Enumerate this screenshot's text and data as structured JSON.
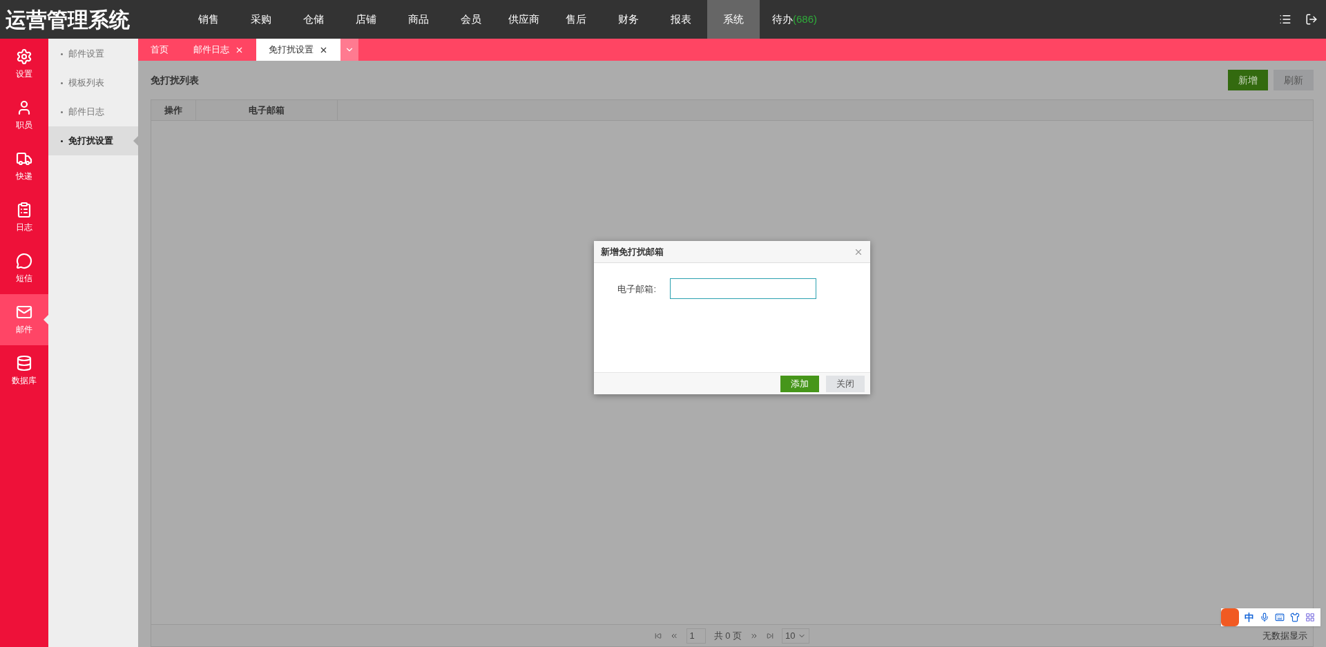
{
  "app_title": "运营管理系统",
  "top_nav": [
    {
      "label": "销售",
      "selected": false
    },
    {
      "label": "采购",
      "selected": false
    },
    {
      "label": "仓储",
      "selected": false
    },
    {
      "label": "店铺",
      "selected": false
    },
    {
      "label": "商品",
      "selected": false
    },
    {
      "label": "会员",
      "selected": false
    },
    {
      "label": "供应商",
      "selected": false
    },
    {
      "label": "售后",
      "selected": false
    },
    {
      "label": "财务",
      "selected": false
    },
    {
      "label": "报表",
      "selected": false
    },
    {
      "label": "系统",
      "selected": true
    }
  ],
  "todo": {
    "label": "待办",
    "count": "(686)"
  },
  "side_nav": [
    {
      "label": "设置",
      "kind": "gear",
      "selected": false
    },
    {
      "label": "职员",
      "kind": "user",
      "selected": false
    },
    {
      "label": "快递",
      "kind": "truck",
      "selected": false
    },
    {
      "label": "日志",
      "kind": "clipboard",
      "selected": false
    },
    {
      "label": "短信",
      "kind": "chat",
      "selected": false
    },
    {
      "label": "邮件",
      "kind": "mail",
      "selected": true
    },
    {
      "label": "数据库",
      "kind": "database",
      "selected": false
    }
  ],
  "sub_nav": [
    {
      "label": "邮件设置",
      "selected": false
    },
    {
      "label": "模板列表",
      "selected": false
    },
    {
      "label": "邮件日志",
      "selected": false
    },
    {
      "label": "免打扰设置",
      "selected": true
    }
  ],
  "tabs": [
    {
      "label": "首页",
      "closable": false,
      "selected": false
    },
    {
      "label": "邮件日志",
      "closable": true,
      "selected": false
    },
    {
      "label": "免打扰设置",
      "closable": true,
      "selected": true
    }
  ],
  "page_title": "免打扰列表",
  "toolbar_buttons": [
    {
      "label": "新增",
      "kind": "primary"
    },
    {
      "label": "刷新",
      "kind": "default"
    }
  ],
  "table": {
    "columns": [
      "操作",
      "电子邮箱"
    ]
  },
  "pager": {
    "page": "1",
    "total": "共 0 页",
    "page_size": "10",
    "empty_text": "无数据显示"
  },
  "dialog": {
    "title": "新增免打扰邮箱",
    "field_label": "电子邮箱:",
    "buttons": [
      {
        "label": "添加",
        "kind": "primary"
      },
      {
        "label": "关闭",
        "kind": "default"
      }
    ]
  },
  "ime_bar": {
    "mode": "中"
  }
}
